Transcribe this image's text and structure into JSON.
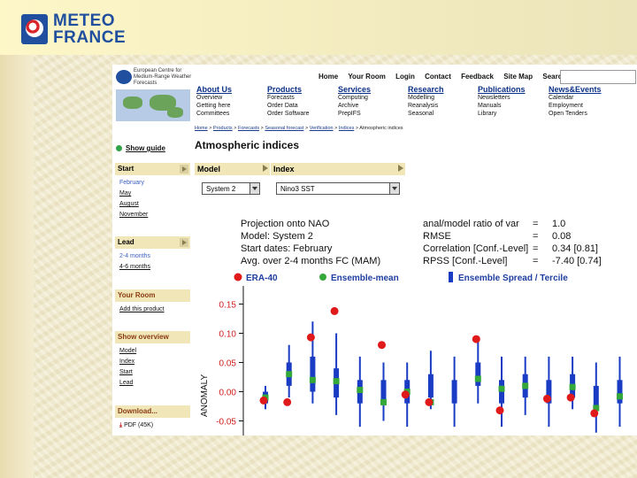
{
  "brand": {
    "line1": "METEO",
    "line2": "FRANCE"
  },
  "ecmwf": {
    "name": "European Centre for Medium-Range Weather Forecasts"
  },
  "topnav": [
    "Home",
    "Your Room",
    "Login",
    "Contact",
    "Feedback",
    "Site Map",
    "Search:"
  ],
  "sections": [
    {
      "title": "About Us",
      "items": [
        "Overview",
        "Getting here",
        "Committees"
      ]
    },
    {
      "title": "Products",
      "items": [
        "Forecasts",
        "Order Data",
        "Order Software"
      ]
    },
    {
      "title": "Services",
      "items": [
        "Computing",
        "Archive",
        "PrepIFS"
      ]
    },
    {
      "title": "Research",
      "items": [
        "Modelling",
        "Reanalysis",
        "Seasonal"
      ]
    },
    {
      "title": "Publications",
      "items": [
        "Newsletters",
        "Manuals",
        "Library"
      ]
    },
    {
      "title": "News&Events",
      "items": [
        "Calendar",
        "Employment",
        "Open Tenders"
      ]
    }
  ],
  "breadcrumb": [
    "Home",
    "Products",
    "Forecasts",
    "Seasonal forecast",
    "Verification",
    "Indices",
    "Atmospheric indices"
  ],
  "sidebar": {
    "show_guide": "Show guide",
    "start": {
      "label": "Start",
      "items": [
        "February",
        "May",
        "August",
        "November"
      ],
      "selected": "February"
    },
    "lead": {
      "label": "Lead",
      "items": [
        "2-4 months",
        "4-6 months"
      ],
      "selected": "2-4 months"
    },
    "your_room": {
      "label": "Your Room",
      "items": [
        "Add this product"
      ]
    },
    "show_overview": {
      "label": "Show overview",
      "items": [
        "Model",
        "Index",
        "Start",
        "Lead"
      ]
    },
    "download": {
      "label": "Download...",
      "items": [
        "PDF (45K)"
      ]
    }
  },
  "page_title": "Atmospheric indices",
  "selectors": {
    "model": {
      "label": "Model",
      "value": "System 2"
    },
    "index": {
      "label": "Index",
      "value": "Nino3 SST"
    }
  },
  "stats": {
    "left": [
      "Projection onto NAO",
      "Model: System 2",
      "Start dates: February",
      "Avg. over 2-4 months FC (MAM)"
    ],
    "right": [
      {
        "label": "anal/model ratio of var",
        "eq": "=",
        "value": "1.0"
      },
      {
        "label": "RMSE",
        "eq": "=",
        "value": "0.08"
      },
      {
        "label": "Correlation [Conf.-Level]",
        "eq": "=",
        "value": "0.34 [0.81]"
      },
      {
        "label": "RPSS [Conf.-Level]",
        "eq": "=",
        "value": "-7.40 [0.74]"
      }
    ]
  },
  "colors": {
    "era": "#e0191b",
    "ens": "#35a83a",
    "spread": "#1a3cc4",
    "ticks": "#d11d1d"
  },
  "chart_data": {
    "type": "scatter",
    "ylabel": "ANOMALY",
    "ylim": [
      -0.075,
      0.175
    ],
    "yticks": [
      "0.15",
      "0.10",
      "0.05",
      "0.00",
      "-0.05"
    ],
    "ytick_values": [
      0.15,
      0.1,
      0.05,
      0.0,
      -0.05
    ],
    "legend": [
      "ERA-40",
      "Ensemble-mean",
      "Ensemble Spread / Tercile"
    ],
    "x": [
      1,
      2,
      3,
      4,
      5,
      6,
      7,
      8,
      9,
      10,
      11,
      12,
      13,
      14,
      15,
      16
    ],
    "series": [
      {
        "name": "ERA-40",
        "values": [
          -0.015,
          -0.018,
          0.093,
          0.138,
          null,
          0.08,
          -0.005,
          -0.018,
          null,
          0.09,
          -0.032,
          null,
          -0.012,
          -0.01,
          -0.037,
          null
        ]
      },
      {
        "name": "Ensemble-mean",
        "values": [
          -0.01,
          0.03,
          0.02,
          0.018,
          0.003,
          -0.018,
          0.0,
          -0.018,
          null,
          0.022,
          0.005,
          0.01,
          null,
          0.008,
          -0.028,
          -0.008
        ]
      },
      {
        "name": "Ensemble Spread / Tercile",
        "values": [
          {
            "min": -0.03,
            "q1": -0.02,
            "q3": 0.0,
            "max": 0.01
          },
          {
            "min": -0.01,
            "q1": 0.01,
            "q3": 0.05,
            "max": 0.08
          },
          {
            "min": -0.02,
            "q1": 0.0,
            "q3": 0.06,
            "max": 0.12
          },
          {
            "min": -0.04,
            "q1": -0.01,
            "q3": 0.04,
            "max": 0.1
          },
          {
            "min": -0.06,
            "q1": -0.02,
            "q3": 0.02,
            "max": 0.06
          },
          {
            "min": -0.05,
            "q1": -0.02,
            "q3": 0.02,
            "max": 0.05
          },
          {
            "min": -0.06,
            "q1": -0.02,
            "q3": 0.02,
            "max": 0.05
          },
          {
            "min": -0.03,
            "q1": -0.01,
            "q3": 0.03,
            "max": 0.07
          },
          {
            "min": -0.06,
            "q1": -0.02,
            "q3": 0.02,
            "max": 0.06
          },
          {
            "min": -0.02,
            "q1": 0.01,
            "q3": 0.05,
            "max": 0.09
          },
          {
            "min": -0.06,
            "q1": -0.02,
            "q3": 0.02,
            "max": 0.06
          },
          {
            "min": -0.04,
            "q1": -0.01,
            "q3": 0.03,
            "max": 0.06
          },
          {
            "min": -0.06,
            "q1": -0.02,
            "q3": 0.02,
            "max": 0.06
          },
          {
            "min": -0.03,
            "q1": -0.01,
            "q3": 0.03,
            "max": 0.06
          },
          {
            "min": -0.07,
            "q1": -0.03,
            "q3": 0.01,
            "max": 0.05
          },
          {
            "min": -0.06,
            "q1": -0.02,
            "q3": 0.02,
            "max": 0.06
          }
        ]
      }
    ]
  }
}
